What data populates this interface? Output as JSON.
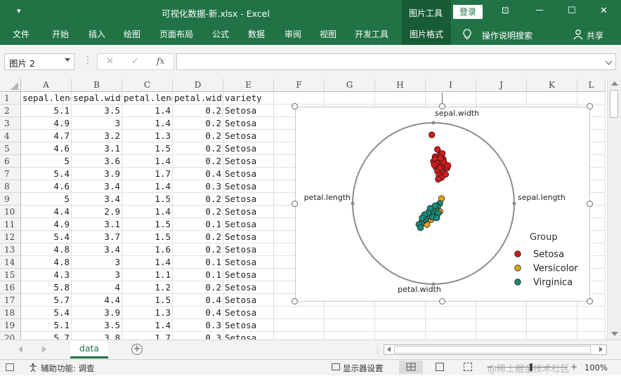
{
  "titlebar": {
    "qat_glyph": "▾",
    "title": "可视化数据-新.xlsx  -  Excel",
    "context_tab": "图片工具",
    "login": "登录",
    "ribbon_toggle": "⊡",
    "minimize": "—",
    "maximize": "☐",
    "close": "✕"
  },
  "ribbon": {
    "tabs": [
      "文件",
      "开始",
      "插入",
      "绘图",
      "页面布局",
      "公式",
      "数据",
      "审阅",
      "视图",
      "开发工具",
      "图片格式"
    ],
    "tell_me": "操作说明搜索",
    "share": "共享"
  },
  "formula_bar": {
    "name_box": "图片 2",
    "cancel": "✕",
    "enter": "✓",
    "fx": "fx",
    "value": ""
  },
  "columns": [
    "A",
    "B",
    "C",
    "D",
    "E",
    "F",
    "G",
    "H",
    "I",
    "J",
    "K",
    "L"
  ],
  "rows": [
    "1",
    "2",
    "3",
    "4",
    "5",
    "6",
    "7",
    "8",
    "9",
    "10",
    "11",
    "12",
    "13",
    "14",
    "15",
    "16",
    "17",
    "18",
    "19",
    "20"
  ],
  "headers": [
    "sepal.length",
    "sepal.width",
    "petal.length",
    "petal.width",
    "variety"
  ],
  "data_rows": [
    [
      "5.1",
      "3.5",
      "1.4",
      "0.2",
      "Setosa"
    ],
    [
      "4.9",
      "3",
      "1.4",
      "0.2",
      "Setosa"
    ],
    [
      "4.7",
      "3.2",
      "1.3",
      "0.2",
      "Setosa"
    ],
    [
      "4.6",
      "3.1",
      "1.5",
      "0.2",
      "Setosa"
    ],
    [
      "5",
      "3.6",
      "1.4",
      "0.2",
      "Setosa"
    ],
    [
      "5.4",
      "3.9",
      "1.7",
      "0.4",
      "Setosa"
    ],
    [
      "4.6",
      "3.4",
      "1.4",
      "0.3",
      "Setosa"
    ],
    [
      "5",
      "3.4",
      "1.5",
      "0.2",
      "Setosa"
    ],
    [
      "4.4",
      "2.9",
      "1.4",
      "0.2",
      "Setosa"
    ],
    [
      "4.9",
      "3.1",
      "1.5",
      "0.1",
      "Setosa"
    ],
    [
      "5.4",
      "3.7",
      "1.5",
      "0.2",
      "Setosa"
    ],
    [
      "4.8",
      "3.4",
      "1.6",
      "0.2",
      "Setosa"
    ],
    [
      "4.8",
      "3",
      "1.4",
      "0.1",
      "Setosa"
    ],
    [
      "4.3",
      "3",
      "1.1",
      "0.1",
      "Setosa"
    ],
    [
      "5.8",
      "4",
      "1.2",
      "0.2",
      "Setosa"
    ],
    [
      "5.7",
      "4.4",
      "1.5",
      "0.4",
      "Setosa"
    ],
    [
      "5.4",
      "3.9",
      "1.3",
      "0.4",
      "Setosa"
    ],
    [
      "5.1",
      "3.5",
      "1.4",
      "0.3",
      "Setosa"
    ],
    [
      "5.7",
      "3.8",
      "1.7",
      "0.3",
      "Setosa"
    ]
  ],
  "sheet_tabs": [
    "data"
  ],
  "status": {
    "accessibility": "辅助功能: 调查",
    "display_settings": "显示器设置",
    "zoom": "100%",
    "watermark": "@稀土掘金技术社区",
    "zoom_minus": "−",
    "zoom_plus": "+",
    "add_sheet": "+"
  },
  "colors": {
    "excel_green": "#217346",
    "setosa": "#d7191c",
    "versicolor": "#e8a317",
    "virginica": "#1a8a7a"
  },
  "chart_data": {
    "type": "scatter",
    "subtype": "radviz",
    "anchors": [
      "sepal.length",
      "sepal.width",
      "petal.length",
      "petal.width"
    ],
    "legend_title": "Group",
    "legend_position": "right",
    "series": [
      {
        "name": "Setosa",
        "points": [
          [
            -0.02,
            0.85
          ],
          [
            0.05,
            0.67
          ],
          [
            0.08,
            0.6
          ],
          [
            0.02,
            0.58
          ],
          [
            0.12,
            0.55
          ],
          [
            0.0,
            0.52
          ],
          [
            0.1,
            0.5
          ],
          [
            0.06,
            0.47
          ],
          [
            0.14,
            0.45
          ],
          [
            0.03,
            0.45
          ],
          [
            0.09,
            0.42
          ],
          [
            0.17,
            0.44
          ],
          [
            0.05,
            0.4
          ],
          [
            0.12,
            0.38
          ],
          [
            0.07,
            0.35
          ],
          [
            0.15,
            0.36
          ],
          [
            0.02,
            0.55
          ],
          [
            0.11,
            0.62
          ],
          [
            0.04,
            0.5
          ],
          [
            0.13,
            0.51
          ],
          [
            0.08,
            0.44
          ],
          [
            0.1,
            0.32
          ],
          [
            0.06,
            0.3
          ],
          [
            0.18,
            0.47
          ],
          [
            0.01,
            0.48
          ],
          [
            0.09,
            0.56
          ]
        ]
      },
      {
        "name": "Versicolor",
        "points": [
          [
            0.1,
            0.06
          ],
          [
            -0.05,
            -0.1
          ],
          [
            0.0,
            -0.12
          ],
          [
            -0.1,
            -0.15
          ],
          [
            0.02,
            -0.05
          ],
          [
            -0.03,
            -0.2
          ],
          [
            -0.12,
            -0.2
          ],
          [
            0.04,
            -0.16
          ],
          [
            -0.08,
            -0.26
          ],
          [
            0.06,
            -0.02
          ],
          [
            -0.15,
            -0.24
          ],
          [
            0.08,
            -0.1
          ]
        ]
      },
      {
        "name": "Virginica",
        "points": [
          [
            0.08,
            -0.0
          ],
          [
            0.05,
            -0.04
          ],
          [
            0.03,
            -0.08
          ],
          [
            0.0,
            -0.1
          ],
          [
            -0.02,
            -0.13
          ],
          [
            -0.05,
            -0.15
          ],
          [
            -0.08,
            -0.17
          ],
          [
            -0.1,
            -0.2
          ],
          [
            -0.13,
            -0.22
          ],
          [
            -0.15,
            -0.25
          ],
          [
            -0.18,
            -0.26
          ],
          [
            0.02,
            -0.03
          ],
          [
            -0.04,
            -0.06
          ],
          [
            -0.07,
            -0.12
          ],
          [
            -0.01,
            -0.17
          ],
          [
            -0.11,
            -0.14
          ],
          [
            0.06,
            -0.12
          ],
          [
            -0.14,
            -0.18
          ],
          [
            -0.16,
            -0.3
          ],
          [
            0.04,
            -0.18
          ]
        ]
      }
    ]
  }
}
